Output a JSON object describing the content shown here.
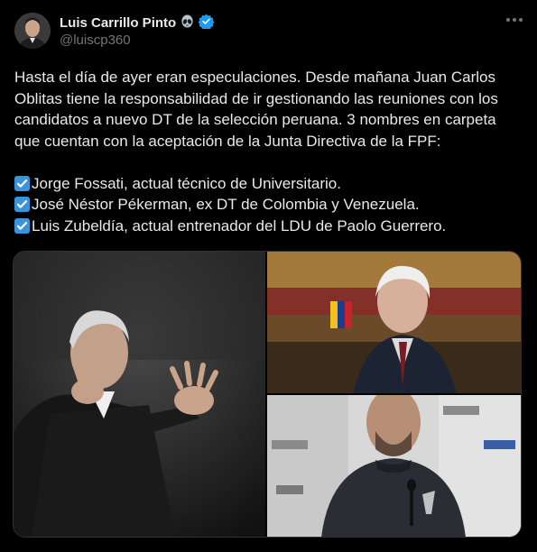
{
  "author": {
    "name": "Luis Carrillo Pinto",
    "handle": "@luiscp360",
    "emoji_icon": "alien-icon",
    "verified_icon": "verified-badge-icon",
    "verified_color": "#1d9bf0"
  },
  "tweet": {
    "paragraph": "Hasta el día de ayer eran especulaciones. Desde mañana Juan Carlos Oblitas tiene la responsabilidad de ir gestionando las reuniones con los candidatos a nuevo DT de la selección peruana. 3 nombres en carpeta que cuentan con la aceptación de la Junta Directiva de la FPF:",
    "items": [
      "Jorge Fossati, actual técnico de Universitario.",
      "José Néstor Pékerman, ex DT de Colombia y Venezuela.",
      "Luis Zubeldía, actual entrenador del LDU de Paolo Guerrero."
    ],
    "check_icon": "check-mark-button-icon",
    "check_color": "#3b94d9"
  },
  "media": {
    "photos": [
      "photo-jorge-fossati",
      "photo-jose-pekerman",
      "photo-luis-zubeldia"
    ]
  }
}
